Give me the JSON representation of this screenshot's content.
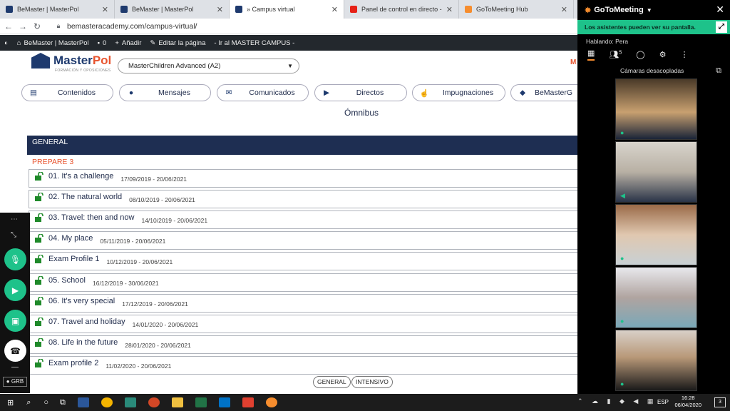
{
  "browser": {
    "tabs": [
      {
        "label": "BeMaster | MasterPol",
        "color": "#1e3a6e"
      },
      {
        "label": "BeMaster | MasterPol",
        "color": "#1e3a6e"
      },
      {
        "label": "» Campus virtual",
        "color": "#1e3a6e"
      },
      {
        "label": "Panel de control en directo - You",
        "color": "#e62117"
      },
      {
        "label": "GoToMeeting Hub",
        "color": "#f68d2e"
      }
    ],
    "url": "bemasteracademy.com/campus-virtual/"
  },
  "adminbar": {
    "site": "BeMaster | MasterPol",
    "comments": "0",
    "add": "Añadir",
    "edit": "Editar la página",
    "campus": "- Ir al MASTER CAMPUS -"
  },
  "page": {
    "logo_name": "MasterPol",
    "logo_sub": "FORMACIÓN Y OPOSICIONES",
    "course_select": "MasterChildren Advanced (A2)",
    "right_cut": "M",
    "nav": [
      {
        "label": "Contenidos",
        "icon": "book-icon"
      },
      {
        "label": "Mensajes",
        "icon": "chat-icon"
      },
      {
        "label": "Comunicados",
        "icon": "mail-icon"
      },
      {
        "label": "Directos",
        "icon": "play-icon"
      },
      {
        "label": "Impugnaciones",
        "icon": "pointer-icon"
      },
      {
        "label": "BeMasterG",
        "icon": "gamepad-icon"
      }
    ],
    "heading": "Ómnibus",
    "section": "GENERAL",
    "group": "PREPARE 3",
    "lessons": [
      {
        "title": "01. It's a challenge",
        "dates": "17/09/2019 - 20/06/2021"
      },
      {
        "title": "02. The natural world",
        "dates": "08/10/2019 - 20/06/2021"
      },
      {
        "title": "03. Travel: then and now",
        "dates": "14/10/2019 - 20/06/2021"
      },
      {
        "title": "04. My place",
        "dates": "05/11/2019 - 20/06/2021"
      },
      {
        "title": "Exam Profile 1",
        "dates": "10/12/2019 - 20/06/2021"
      },
      {
        "title": "05. School",
        "dates": "16/12/2019 - 30/06/2021"
      },
      {
        "title": "06. It's very special",
        "dates": "17/12/2019 - 20/06/2021"
      },
      {
        "title": "07. Travel and holiday",
        "dates": "14/01/2020 - 20/06/2021"
      },
      {
        "title": "08. Life in the future",
        "dates": "28/01/2020 - 20/06/2021"
      },
      {
        "title": "Exam profile 2",
        "dates": "11/02/2020 - 20/06/2021"
      }
    ],
    "pills": [
      "GENERAL",
      "INTENSIVO"
    ]
  },
  "gotomeeting": {
    "brand": "GoToMeeting",
    "notice": "Los asistentes pueden ver su pantalla.",
    "speaking": "Hablando: Pera",
    "attendee_count": "5",
    "cameras": "Cámaras desacopladas",
    "rec": "GRB"
  },
  "colors": {
    "accent": "#1ec28a",
    "navy": "#1e2e52",
    "orange": "#e8532d",
    "lock": "#1f8a2a"
  },
  "taskbar": {
    "lang": "ESP",
    "time": "16:28",
    "date": "06/04/2020",
    "notifications": "3"
  }
}
